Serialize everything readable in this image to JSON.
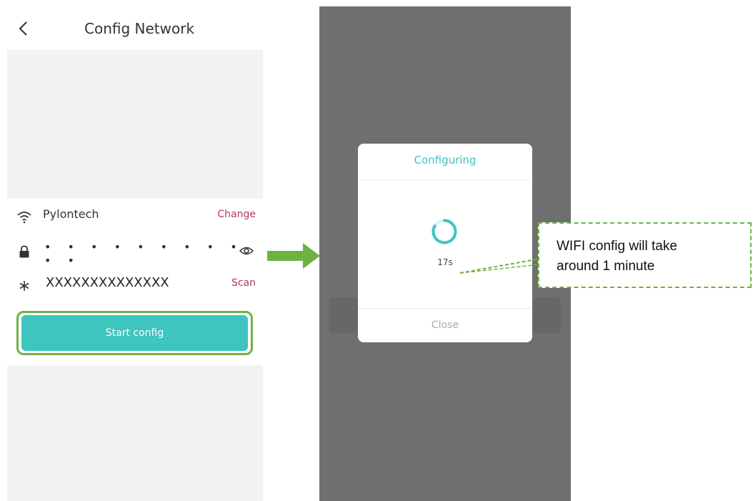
{
  "left_screen": {
    "header": {
      "title": "Config Network",
      "back_icon": "chevron-left-icon"
    },
    "wifi": {
      "ssid": "Pylontech",
      "change_label": "Change",
      "icon": "wifi-icon"
    },
    "password": {
      "masked_value": "• • • • • • • • • • •",
      "icon": "lock-icon",
      "toggle_icon": "eye-icon"
    },
    "serial": {
      "value": "XXXXXXXXXXXXXX",
      "scan_label": "Scan",
      "icon": "asterisk-icon"
    },
    "start_button": {
      "label": "Start config"
    }
  },
  "right_screen": {
    "modal": {
      "title": "Configuring",
      "countdown": "17s",
      "close_label": "Close",
      "spinner_icon": "spinner-icon"
    }
  },
  "callout": {
    "line1": "WIFI config will take",
    "line2": "around 1 minute"
  },
  "colors": {
    "teal": "#3ec5bf",
    "link": "#b0386a",
    "annotation_green": "#6fb244",
    "overlay_gray": "#6f6f6f"
  }
}
